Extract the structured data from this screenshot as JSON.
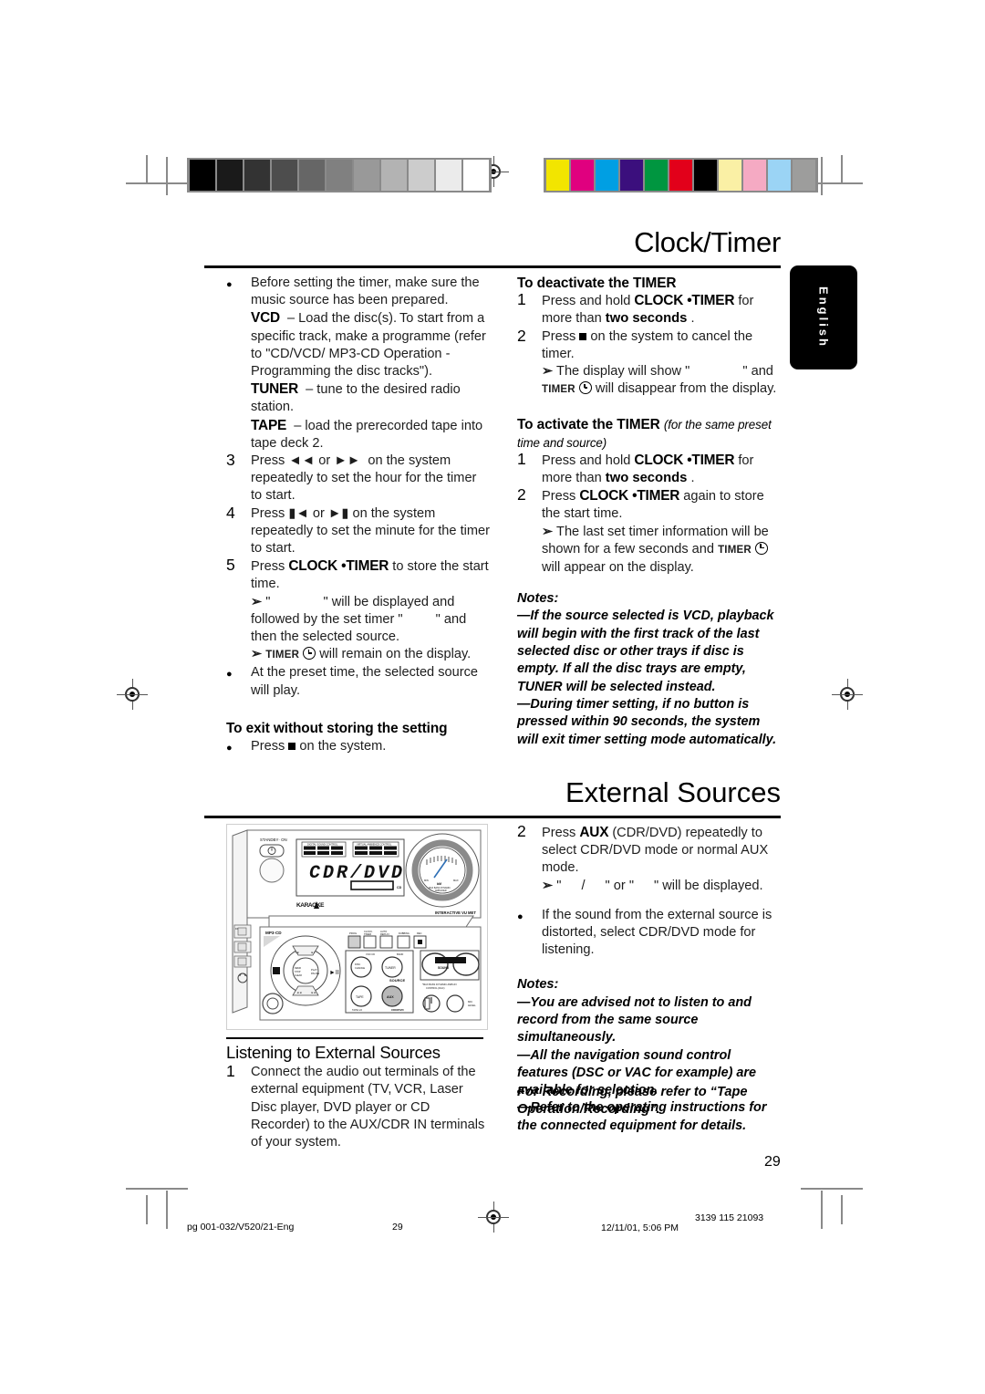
{
  "page": {
    "number": "29",
    "language_tab": "English"
  },
  "sections": [
    {
      "title": "Clock/Timer"
    },
    {
      "title": "External Sources"
    }
  ],
  "clock_timer": {
    "left_column": [
      {
        "marker": "●",
        "marker_type": "bullet",
        "lines": [
          "Before setting the timer, make sure the music",
          "source has been prepared.",
          "VCD – Load the disc(s). To start from a specific",
          "track, make a programme (refer to “CD/VCD/",
          "MP3-CD Operation - Programming the disc",
          "tracks”).",
          "TUNER – tune to the desired radio station.",
          "TAPE – load the prerecorded tape into tape",
          "deck 2."
        ],
        "bold_terms": [
          "VCD",
          "TUNER",
          "TAPE"
        ]
      },
      {
        "marker": "3",
        "marker_type": "number",
        "lines": [
          "Press ◀◀ or ▶▶ on the system repeatedly to set",
          "the hour for the timer to start."
        ]
      },
      {
        "marker": "4",
        "marker_type": "number",
        "lines": [
          "Press ⏮ or ⏭ on the system repeatedly to set",
          "the minute for the timer to start."
        ]
      },
      {
        "marker": "5",
        "marker_type": "number",
        "lines": [
          "Press CLOCK •TIMER to store the start time.",
          "➔ \" \" will be displayed and followed",
          "by the set timer \" \" and then the selected",
          "source.",
          "➔ TIMER ⏱ will remain on the display."
        ],
        "bold_terms": [
          "CLOCK •TIMER"
        ]
      },
      {
        "marker": "●",
        "marker_type": "bullet",
        "lines": [
          "At the preset time, the selected source will play."
        ]
      }
    ],
    "exit_heading": "To exit without storing the setting",
    "exit_item": {
      "marker": "●",
      "marker_type": "bullet",
      "lines": [
        "Press ■ on the system."
      ]
    },
    "deactivate_heading": "To deactivate the TIMER",
    "deactivate_steps": [
      {
        "marker": "1",
        "lines": [
          "Press and hold CLOCK •TIMER for more than",
          "two seconds ."
        ]
      },
      {
        "marker": "2",
        "lines": [
          "Press ■ on the system to cancel the timer.",
          "➔ The display will show \" \" and TIMER ⏱",
          "will disappear from the display."
        ]
      }
    ],
    "activate_heading": "To activate the TIMER",
    "activate_heading_paren": "(for the same preset time and source)",
    "activate_steps": [
      {
        "marker": "1",
        "lines": [
          "Press and hold CLOCK •TIMER for more than",
          "two seconds ."
        ]
      },
      {
        "marker": "2",
        "lines": [
          "Press CLOCK •TIMER again to store the start",
          "time.",
          "➔ The last set timer information will be shown",
          "for a few seconds and TIMER ⏱ will appear on",
          "the display."
        ]
      }
    ],
    "notes_label": "Notes:",
    "notes": [
      "—If the source selected is VCD, playback will begin with the first track of the last selected disc or other trays if disc is empty. If all the disc trays are empty, TUNER will be selected instead.",
      "—During timer setting, if no button is pressed within 90 seconds, the system will exit timer setting mode automatically."
    ]
  },
  "external_sources": {
    "subheading": "Listening to External Sources",
    "step1": {
      "marker": "1",
      "lines": [
        "Connect the audio out terminals of the external",
        "equipment (TV, VCR, Laser Disc player, DVD",
        "player or CD Recorder) to the AUX/CDR IN",
        "terminals of your system."
      ]
    },
    "step2": {
      "marker": "2",
      "lines": [
        "Press AUX (CDR/DVD) repeatedly to select",
        "CDR/DVD mode or normal AUX mode.",
        "➔ \" / \" or \" \" will be displayed."
      ],
      "bold_terms": [
        "AUX"
      ]
    },
    "bullet": {
      "marker": "●",
      "lines": [
        "If the sound from the external source is",
        "distorted, select CDR/DVD mode for listening."
      ]
    },
    "notes_label": "Notes:",
    "notes": [
      "—You are advised not to listen to and record from the same source simultaneously.",
      "—All the navigation sound control features (DSC or VAC for example) are available for selection.",
      "—Refer to the operating instructions for the connected equipment for details."
    ],
    "recording_callout": "For Recording, please refer to “Tape Operation/Recording”."
  },
  "product_photo": {
    "display_text": "CDR/DVD",
    "labels": {
      "standby": "STANDBY· ON",
      "dsc": "DIGITAL SOUND CONTROL",
      "vac": "VIRTUAL AMBIENCE CONTROL",
      "karaoke": "KARAOKE",
      "vu": "INTERACTIVE VU MET",
      "mp3cd": "MP3·CD",
      "source": "SOURCE",
      "aux": "AUX",
      "cdr_dvd": "CDR/DVD",
      "tape": "TAPE",
      "tuner": "TUNER",
      "play_pause": "PLAY PAUSE",
      "max_sound": "MAX SOUND",
      "max_note": "*MAX BASS DYNAMIC AMPLIFIER CONTROL (DAC)",
      "mic_level": "MIC LEVEL",
      "prog": "PROG",
      "clock_timer": "CLOCK· TIMER",
      "auto_replay": "AUTO REPLAY",
      "dubbing": "DUBBING",
      "rec": "REC"
    }
  },
  "footer": {
    "left": "pg 001-032/V520/21-Eng",
    "center": "29",
    "date": "12/11/01, 5:06 PM",
    "code": "3139 115 21093"
  },
  "calibration": {
    "grey_swatches": [
      "#000000",
      "#1a1a1a",
      "#333333",
      "#4d4d4d",
      "#666666",
      "#808080",
      "#999999",
      "#b3b3b3",
      "#cccccc",
      "#ebebeb",
      "#ffffff"
    ],
    "colour_swatches": [
      "#f2e500",
      "#e0007f",
      "#009fe3",
      "#3b0f7d",
      "#009640",
      "#e2001a",
      "#000000",
      "#faf0a5",
      "#f5aac3",
      "#9bd4f5",
      "#9d9d9c"
    ]
  }
}
